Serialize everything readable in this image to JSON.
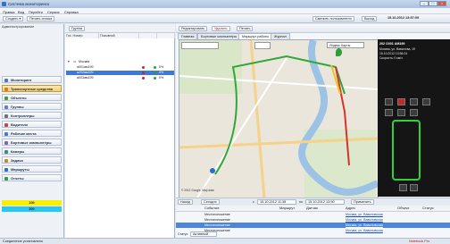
{
  "window": {
    "title": "Система мониторинга",
    "min": "–",
    "max": "□",
    "close": "×"
  },
  "menu": [
    "Правка",
    "Вид",
    "Перейти",
    "Сервис",
    "Справка"
  ],
  "toolbar": {
    "create": "Создать ▾",
    "print_list": "Печать списка",
    "switch_user": "Сменить пользователя",
    "exit": "Выход",
    "datetime": "15.10.2012 13:57:09"
  },
  "left_panel": {
    "header": "Администрирование",
    "nav_items": [
      {
        "label": "Мониторинг",
        "color": "#4a78c8"
      },
      {
        "label": "Транспортные средства",
        "color": "#d87a1c"
      },
      {
        "label": "Объекты",
        "color": "#4a9a3c"
      },
      {
        "label": "Группы",
        "color": "#5f7fbf"
      },
      {
        "label": "Контроллеры",
        "color": "#6f6f6f"
      },
      {
        "label": "Водители",
        "color": "#c04a4a"
      },
      {
        "label": "Рабочие места",
        "color": "#4a78c8"
      },
      {
        "label": "Бортовые компьютеры",
        "color": "#8a5fbf"
      },
      {
        "label": "Камеры",
        "color": "#2f8f8f"
      },
      {
        "label": "Задачи",
        "color": "#bf8f2f"
      },
      {
        "label": "Маршруты",
        "color": "#2f6fbf"
      },
      {
        "label": "Отчеты",
        "color": "#2f9f4f"
      }
    ],
    "yellow_badge": "100",
    "cyan_badge": "300"
  },
  "vehicle_panel": {
    "group_label": "Группа",
    "columns": [
      "Гос. Номер",
      "Позывной",
      "",
      ""
    ],
    "group_name": "Москва",
    "rows": [
      {
        "plate": "а001ам199",
        "pct": "0%",
        "selected": false
      },
      {
        "plate": "а202ам199",
        "pct": "0%",
        "selected": true
      },
      {
        "plate": "а003ам199",
        "pct": "0%",
        "selected": false
      }
    ]
  },
  "right_panel": {
    "toolbar": {
      "edit": "Редактировать",
      "delete": "Удалить",
      "print": "Печать"
    },
    "tabs": [
      "Главная",
      "Бортовые компьютеры",
      "Маршрут работы",
      "Журнал"
    ],
    "map_source": "Яндекс Карты",
    "map_copyright": "© 2012 Google, Map data",
    "vehicle_info": {
      "line1": "202   О001 АМ199",
      "line2": "Москва, ул. Вавилова, 19",
      "line3": "15.10.2012 13:56:24",
      "line4": "Скорость: 0 км/ч"
    },
    "events_toolbar": {
      "back": "Назад",
      "today": "Сегодня",
      "from": "с",
      "date_from": "15.10.2012 11:38",
      "to": "по",
      "date_to": "15.10.2012 13:50",
      "apply": "Применить"
    },
    "events_columns": [
      "",
      "Событие",
      "Маршрут",
      "Датчик",
      "Адрес",
      "Объект",
      "Статус"
    ],
    "events": [
      {
        "event": "Местоположение",
        "address": "Москва, ул. Вавиловская",
        "selected": false
      },
      {
        "event": "Местоположение",
        "address": "Москва, ул. Вавиловская",
        "selected": false
      },
      {
        "event": "Местоположение",
        "address": "Москва, ул. Вавиловская",
        "selected": true
      },
      {
        "event": "Местоположение",
        "address": "Москва, ул. Вавиловская",
        "selected": false
      }
    ],
    "filter": {
      "label": "Статус",
      "value": "Активный"
    }
  },
  "status": {
    "left": "Соединение установлено",
    "right": "Notebook Pro"
  }
}
